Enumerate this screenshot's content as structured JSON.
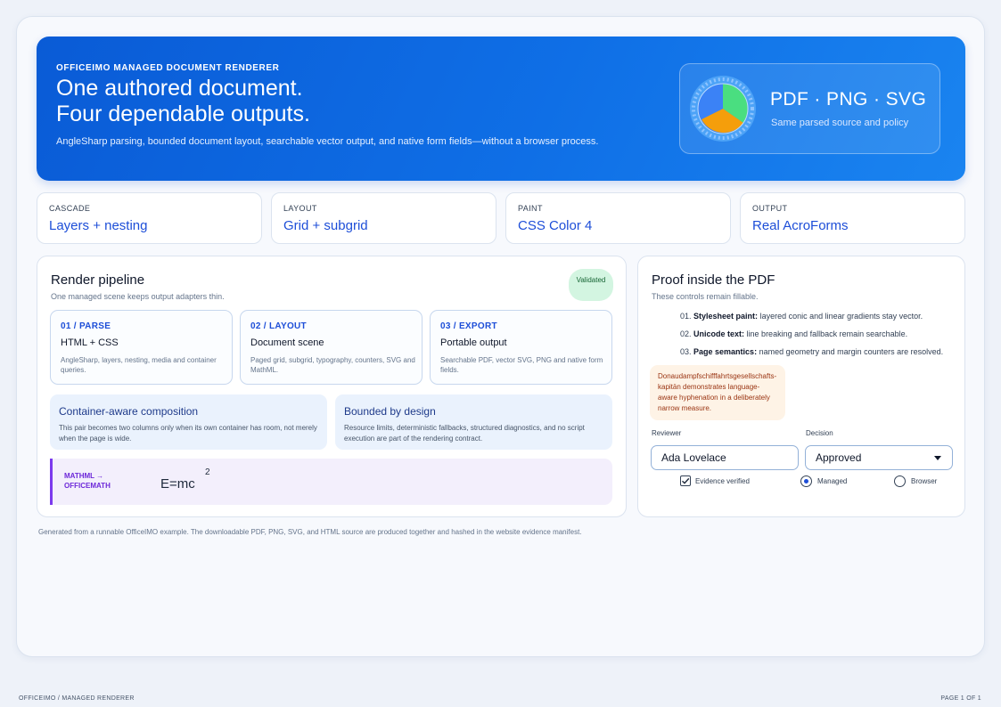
{
  "hero": {
    "eyebrow": "OFFICEIMO MANAGED DOCUMENT RENDERER",
    "title_line1": "One authored document.",
    "title_line2": "Four dependable outputs.",
    "lede": "AngleSharp parsing, bounded document layout, searchable vector output, and native form fields—without a browser process.",
    "formats": "PDF · PNG · SVG",
    "formats_sub": "Same parsed source and policy"
  },
  "stats": [
    {
      "key": "CASCADE",
      "value": "Layers + nesting"
    },
    {
      "key": "LAYOUT",
      "value": "Grid + subgrid"
    },
    {
      "key": "PAINT",
      "value": "CSS Color 4"
    },
    {
      "key": "OUTPUT",
      "value": "Real AcroForms"
    }
  ],
  "pipeline": {
    "title": "Render pipeline",
    "caption": "One managed scene keeps output adapters thin.",
    "status": "Validated",
    "steps": [
      {
        "num": "01 / PARSE",
        "title": "HTML + CSS",
        "desc": "AngleSharp, layers, nesting, media and container queries."
      },
      {
        "num": "02 / LAYOUT",
        "title": "Document scene",
        "desc": "Paged grid, subgrid, typography, counters, SVG and MathML."
      },
      {
        "num": "03 / EXPORT",
        "title": "Portable output",
        "desc": "Searchable PDF, vector SVG, PNG and native form fields."
      }
    ],
    "features": [
      {
        "title": "Container-aware composition",
        "desc": "This pair becomes two columns only when its own container has room, not merely when the page is wide."
      },
      {
        "title": "Bounded by design",
        "desc": "Resource limits, deterministic fallbacks, structured diagnostics, and no script execution are part of the rendering contract."
      }
    ],
    "math": {
      "tag_line1": "MATHML →",
      "tag_line2": "OFFICEMATH",
      "expr": "E=mc",
      "exponent": "2"
    }
  },
  "proof": {
    "title": "Proof inside the PDF",
    "caption": "These controls remain fillable.",
    "items": [
      {
        "num": "01.",
        "bold": "Stylesheet paint:",
        "text": " layered conic and linear gradients stay vector."
      },
      {
        "num": "02.",
        "bold": "Unicode text:",
        "text": " line breaking and fallback remain searchable."
      },
      {
        "num": "03.",
        "bold": "Page semantics:",
        "text": " named geometry and margin counters are resolved."
      }
    ],
    "hyphenation": "Donaudampfschifffahrtsgesellschafts-kapitän demonstrates language-aware hyphenation in a deliberately narrow measure.",
    "reviewer_label": "Reviewer",
    "reviewer_value": "Ada Lovelace",
    "decision_label": "Decision",
    "decision_value": "Approved",
    "checkbox_label": "Evidence verified",
    "checkbox_checked": true,
    "radio_managed": "Managed",
    "radio_browser": "Browser",
    "radio_selected": "Managed"
  },
  "footnote": "Generated from a runnable OfficeIMO example. The downloadable PDF, PNG, SVG, and HTML source are produced together and hashed in the website evidence manifest.",
  "footer": {
    "left": "OFFICEIMO / MANAGED RENDERER",
    "right": "PAGE 1 OF 1"
  },
  "colors": {
    "accent": "#1d4ed8",
    "hero": "#0f6fe6",
    "validated": "#d3f5e1",
    "math": "#7c3aed"
  }
}
